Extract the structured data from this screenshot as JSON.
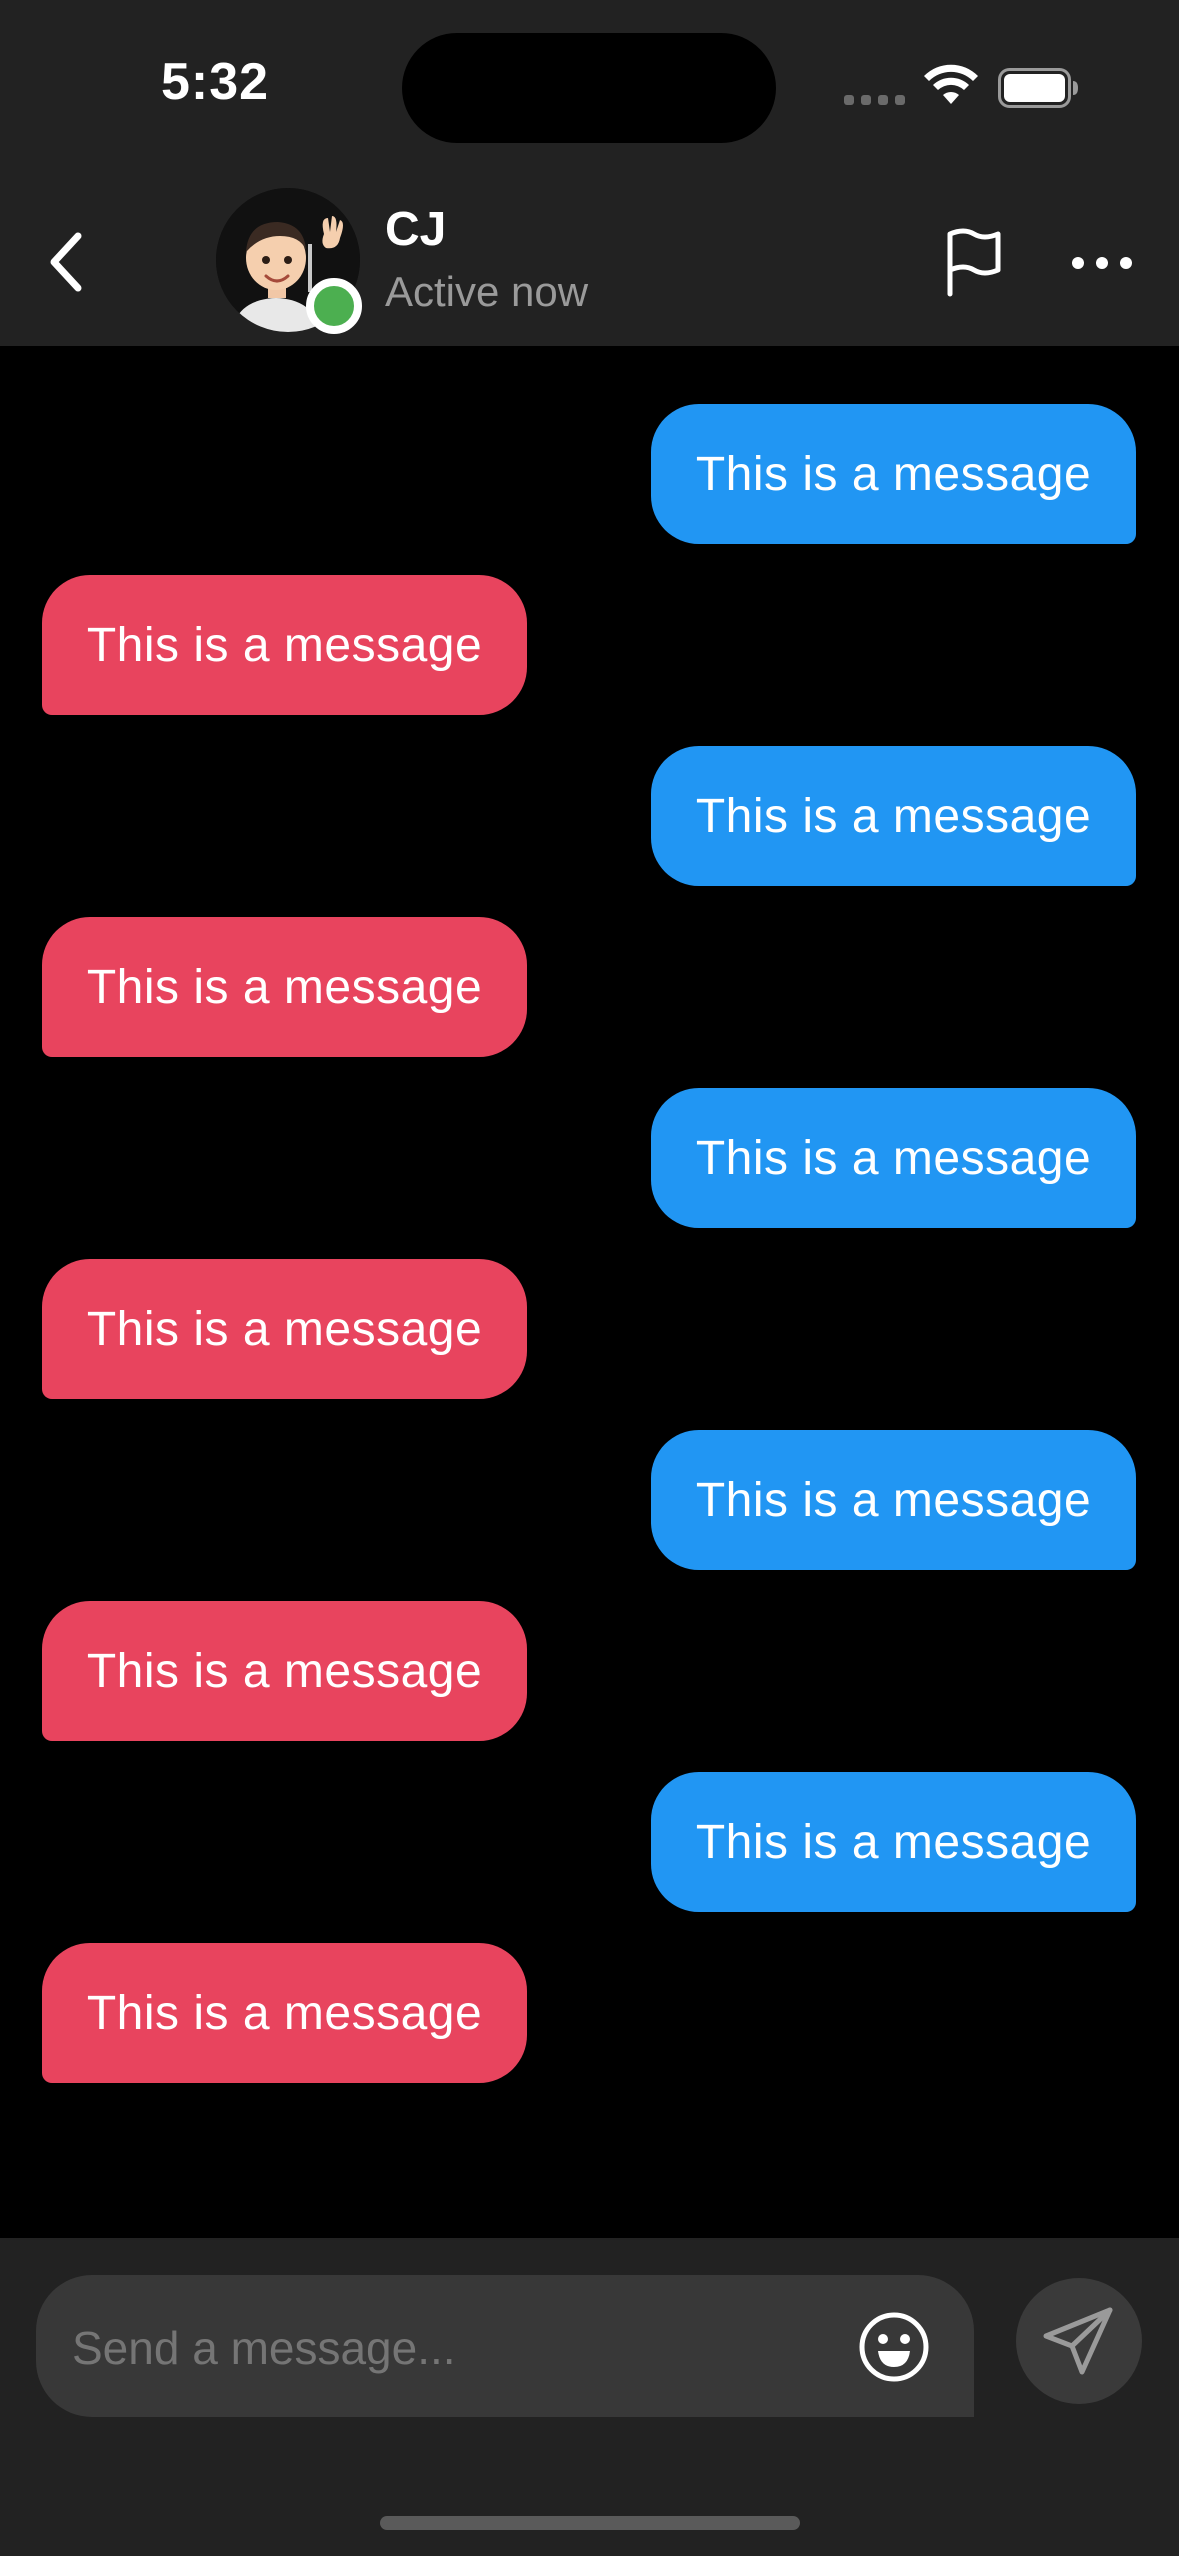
{
  "status_bar": {
    "time": "5:32",
    "icons": [
      "signal-icon",
      "wifi-icon",
      "battery-icon"
    ]
  },
  "header": {
    "contact_name": "CJ",
    "contact_status": "Active now",
    "icons": [
      "back-chevron-icon",
      "avatar",
      "online-indicator",
      "flag-icon",
      "more-icon"
    ],
    "online_color": "#4caf50"
  },
  "messages": [
    {
      "side": "sent",
      "text": "This is a message"
    },
    {
      "side": "received",
      "text": "This is a message"
    },
    {
      "side": "sent",
      "text": "This is a message"
    },
    {
      "side": "received",
      "text": "This is a message"
    },
    {
      "side": "sent",
      "text": "This is a message"
    },
    {
      "side": "received",
      "text": "This is a message"
    },
    {
      "side": "sent",
      "text": "This is a message"
    },
    {
      "side": "received",
      "text": "This is a message"
    },
    {
      "side": "sent",
      "text": "This is a message"
    },
    {
      "side": "received",
      "text": "This is a message"
    }
  ],
  "composer": {
    "placeholder": "Send a message...",
    "icons": [
      "emoji-icon",
      "send-icon"
    ]
  },
  "colors": {
    "sent_bubble": "#2196f3",
    "received_bubble": "#e8445e",
    "bar_background": "#222222",
    "chat_background": "#000000"
  }
}
